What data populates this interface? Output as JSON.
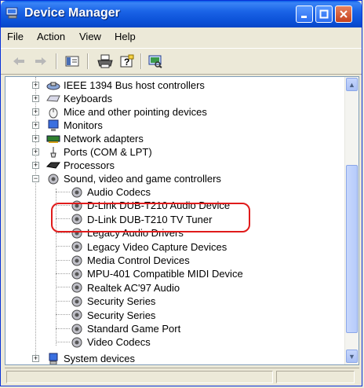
{
  "window": {
    "title": "Device Manager"
  },
  "menu": {
    "items": [
      "File",
      "Action",
      "View",
      "Help"
    ]
  },
  "tree": {
    "items": [
      {
        "label": "IEEE 1394 Bus host controllers",
        "icon": "firewire-icon"
      },
      {
        "label": "Keyboards",
        "icon": "keyboard-icon"
      },
      {
        "label": "Mice and other pointing devices",
        "icon": "mouse-icon"
      },
      {
        "label": "Monitors",
        "icon": "monitor-icon"
      },
      {
        "label": "Network adapters",
        "icon": "network-adapter-icon"
      },
      {
        "label": "Ports (COM & LPT)",
        "icon": "port-icon"
      },
      {
        "label": "Processors",
        "icon": "processor-icon"
      },
      {
        "label": "Sound, video and game controllers",
        "icon": "sound-icon"
      },
      {
        "label": "System devices",
        "icon": "system-device-icon"
      }
    ],
    "children": [
      "Audio Codecs",
      "D-Link DUB-T210 Audio Device",
      "D-Link DUB-T210 TV Tuner",
      "Legacy Audio Drivers",
      "Legacy Video Capture Devices",
      "Media Control Devices",
      "MPU-401 Compatible MIDI Device",
      "Realtek AC'97 Audio",
      "Security Series",
      "Security Series",
      "Standard Game Port",
      "Video Codecs"
    ]
  },
  "colors": {
    "highlight": "#e01b1b",
    "titlebar": "#0a5de8"
  }
}
